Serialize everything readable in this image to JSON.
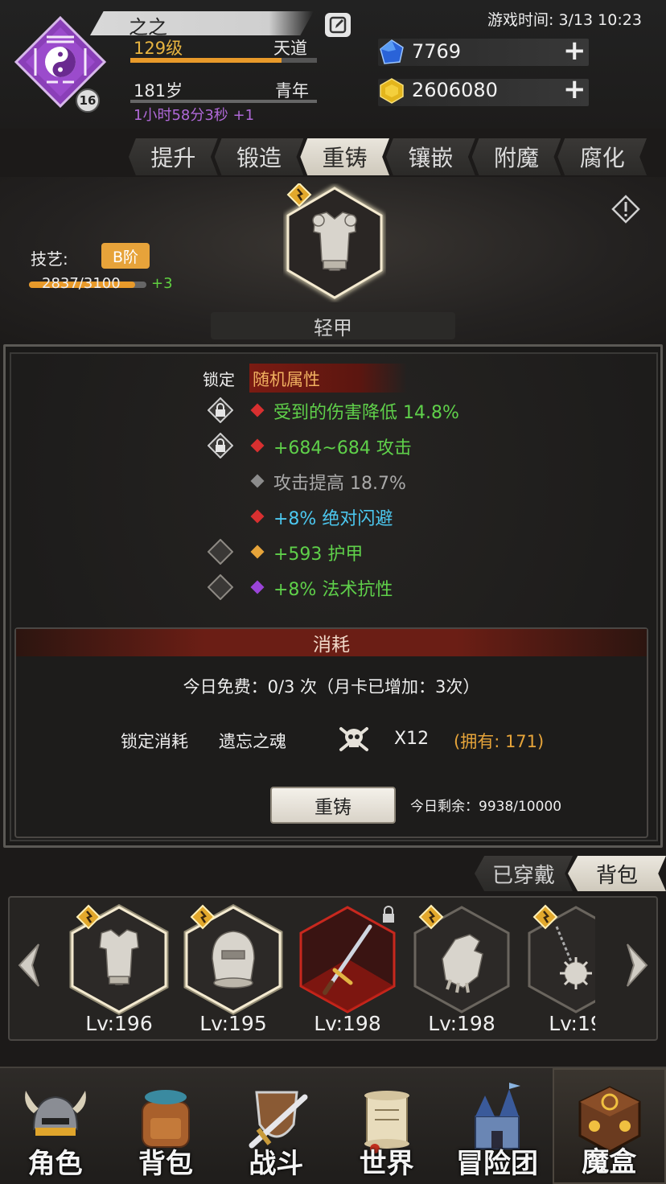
{
  "player": {
    "name": "之之",
    "level": "129级",
    "realm": "天道",
    "age": "181岁",
    "age_stage": "青年",
    "age_timer": "1小时58分3秒 +1",
    "avatar_level": "16",
    "level_progress": 0.81
  },
  "game_time": "游戏时间: 3/13 10:23",
  "resources": {
    "gems": "7769",
    "gold": "2606080"
  },
  "tabs": [
    {
      "label": "提升",
      "active": false
    },
    {
      "label": "锻造",
      "active": false
    },
    {
      "label": "重铸",
      "active": true
    },
    {
      "label": "镶嵌",
      "active": false
    },
    {
      "label": "附魔",
      "active": false
    },
    {
      "label": "腐化",
      "active": false
    }
  ],
  "skill": {
    "label": "技艺:",
    "grade": "B阶",
    "progress": "2837/3100",
    "bonus": "+3"
  },
  "item": {
    "name": "轻甲"
  },
  "attributes": {
    "lock_label": "锁定",
    "header": "随机属性",
    "rows": [
      {
        "text": "受到的伤害降低 14.8%",
        "color": "#5fd04a",
        "gem": "#d83030",
        "lock": "locked"
      },
      {
        "text": "+684~684 攻击",
        "color": "#5fd04a",
        "gem": "#d83030",
        "lock": "locked"
      },
      {
        "text": "攻击提高 18.7%",
        "color": "#a9a9a9",
        "gem": "#8c8c8c",
        "lock": "none"
      },
      {
        "text": "+8% 绝对闪避",
        "color": "#4cc8f0",
        "gem": "#d83030",
        "lock": "none"
      },
      {
        "text": "+593 护甲",
        "color": "#5fd04a",
        "gem": "#e6a43a",
        "lock": "open"
      },
      {
        "text": "+8% 法术抗性",
        "color": "#5fd04a",
        "gem": "#9a44d8",
        "lock": "open"
      }
    ]
  },
  "cost": {
    "title": "消耗",
    "free_today": "今日免费：0/3 次（月卡已增加：3次）",
    "lock_cost_label": "锁定消耗",
    "lock_cost_item": "遗忘之魂",
    "lock_cost_qty": "X12",
    "lock_cost_own": "(拥有: 171)",
    "reforge_button": "重铸",
    "remaining_today": "今日剩余：9938/10000"
  },
  "equip_tabs": [
    {
      "label": "已穿戴",
      "active": false
    },
    {
      "label": "背包",
      "active": true
    }
  ],
  "equipment": [
    {
      "level": "Lv:196",
      "type": "armor",
      "frame": "gold"
    },
    {
      "level": "Lv:195",
      "type": "helmet",
      "frame": "gold"
    },
    {
      "level": "Lv:198",
      "type": "sword",
      "frame": "red"
    },
    {
      "level": "Lv:198",
      "type": "gauntlet",
      "frame": "dark"
    },
    {
      "level": "Lv:19",
      "type": "flail",
      "frame": "dark"
    }
  ],
  "nav": [
    {
      "label": "角色",
      "icon": "helmet-icon"
    },
    {
      "label": "背包",
      "icon": "backpack-icon"
    },
    {
      "label": "战斗",
      "icon": "sword-shield-icon"
    },
    {
      "label": "世界",
      "icon": "scroll-map-icon"
    },
    {
      "label": "冒险团",
      "icon": "castle-icon"
    },
    {
      "label": "魔盒",
      "icon": "magic-cube-icon",
      "active": true
    }
  ]
}
